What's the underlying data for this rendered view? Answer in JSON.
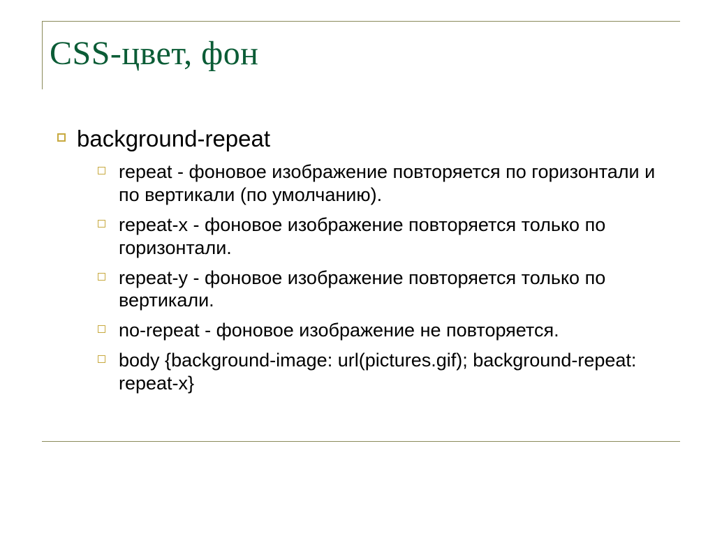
{
  "slide": {
    "title": "CSS-цвет, фон",
    "topic": "background-repeat",
    "items": [
      "repeat - фоновое изображение повторяется по горизонтали и по вертикали (по умолчанию).",
      "repeat-x - фоновое изображение повторяется только по горизонтали.",
      "repeat-y - фоновое изображение повторяется только по вертикали.",
      "no-repeat - фоновое изображение не повторяется.",
      "body {background-image: url(pictures.gif); background-repeat: repeat-x}"
    ]
  },
  "colors": {
    "title": "#0b5c36",
    "bullet_border": "#c7a93f",
    "rule": "#8a8a5a"
  }
}
